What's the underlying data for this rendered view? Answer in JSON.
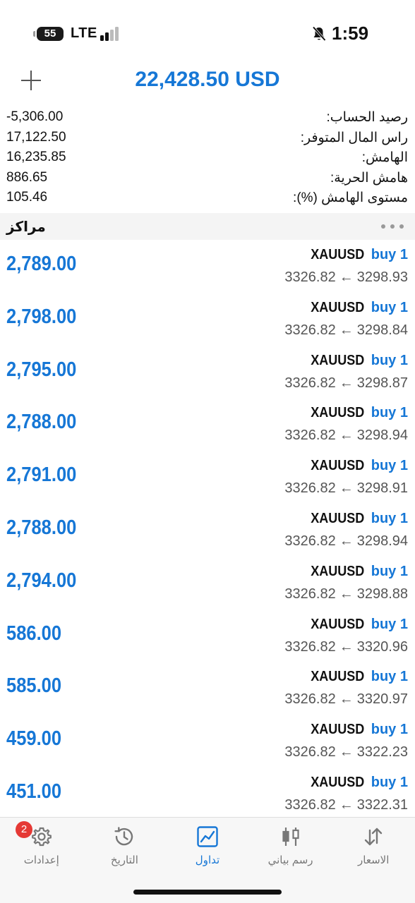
{
  "status_bar": {
    "battery": "55",
    "network": "LTE",
    "time": "1:59"
  },
  "header": {
    "balance": "22,428.50 USD"
  },
  "summary": [
    {
      "label": "رصيد الحساب:",
      "value": "-5,306.00"
    },
    {
      "label": "راس المال المتوفر:",
      "value": "17,122.50"
    },
    {
      "label": "الهامش:",
      "value": "16,235.85"
    },
    {
      "label": "هامش الحرية:",
      "value": "886.65"
    },
    {
      "label": "مستوى الهامش (%):",
      "value": "105.46"
    }
  ],
  "positions_section": {
    "title": "مراكز"
  },
  "positions": [
    {
      "symbol": "XAUUSD",
      "type": "buy 1",
      "open_price": "3298.93",
      "current_price": "3326.82",
      "profit": "2,789.00"
    },
    {
      "symbol": "XAUUSD",
      "type": "buy 1",
      "open_price": "3298.84",
      "current_price": "3326.82",
      "profit": "2,798.00"
    },
    {
      "symbol": "XAUUSD",
      "type": "buy 1",
      "open_price": "3298.87",
      "current_price": "3326.82",
      "profit": "2,795.00"
    },
    {
      "symbol": "XAUUSD",
      "type": "buy 1",
      "open_price": "3298.94",
      "current_price": "3326.82",
      "profit": "2,788.00"
    },
    {
      "symbol": "XAUUSD",
      "type": "buy 1",
      "open_price": "3298.91",
      "current_price": "3326.82",
      "profit": "2,791.00"
    },
    {
      "symbol": "XAUUSD",
      "type": "buy 1",
      "open_price": "3298.94",
      "current_price": "3326.82",
      "profit": "2,788.00"
    },
    {
      "symbol": "XAUUSD",
      "type": "buy 1",
      "open_price": "3298.88",
      "current_price": "3326.82",
      "profit": "2,794.00"
    },
    {
      "symbol": "XAUUSD",
      "type": "buy 1",
      "open_price": "3320.96",
      "current_price": "3326.82",
      "profit": "586.00"
    },
    {
      "symbol": "XAUUSD",
      "type": "buy 1",
      "open_price": "3320.97",
      "current_price": "3326.82",
      "profit": "585.00"
    },
    {
      "symbol": "XAUUSD",
      "type": "buy 1",
      "open_price": "3322.23",
      "current_price": "3326.82",
      "profit": "459.00"
    },
    {
      "symbol": "XAUUSD",
      "type": "buy 1",
      "open_price": "3322.31",
      "current_price": "3326.82",
      "profit": "451.00"
    }
  ],
  "tab_bar": {
    "settings": {
      "label": "إعدادات",
      "badge": "2"
    },
    "history": {
      "label": "التاريخ"
    },
    "trade": {
      "label": "تداول"
    },
    "chart": {
      "label": "رسم بياني"
    },
    "quotes": {
      "label": "الاسعار"
    },
    "active": "trade"
  },
  "colors": {
    "accent": "#1677d6",
    "badge": "#e53935",
    "secondary_text": "#555555"
  }
}
